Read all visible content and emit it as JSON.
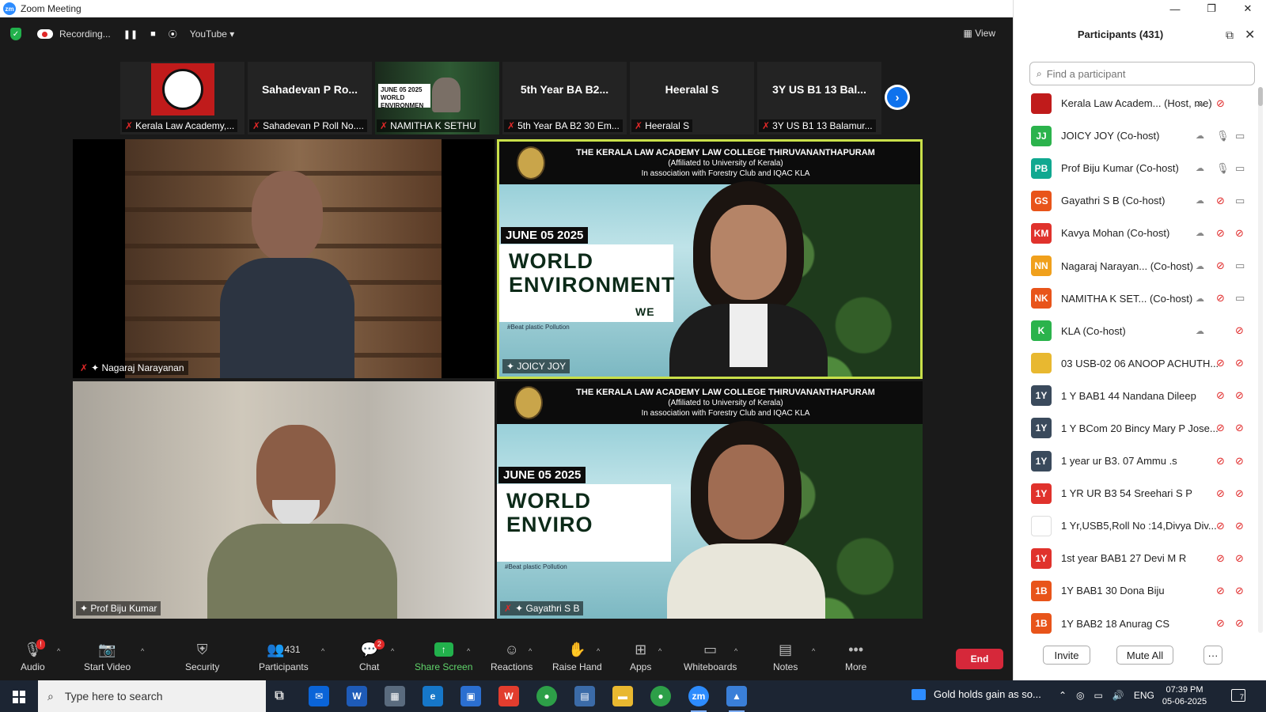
{
  "window": {
    "title": "Zoom Meeting"
  },
  "topbar": {
    "recording_label": "Recording...",
    "stream_label": "YouTube",
    "view_label": "View"
  },
  "thumbnails": [
    {
      "display": "",
      "name": "Kerala Law Academy,..."
    },
    {
      "display": "Sahadevan  P  Ro...",
      "name": "Sahadevan P Roll No...."
    },
    {
      "display": "",
      "name": "NAMITHA K SETHU"
    },
    {
      "display": "5th Year BA B2...",
      "name": "5th Year BA B2 30 Em..."
    },
    {
      "display": "Heeralal S",
      "name": "Heeralal S"
    },
    {
      "display": "3Y US B1 13 Bal...",
      "name": "3Y US B1 13 Balamur..."
    }
  ],
  "thumb_banner": {
    "date": "JUNE 05 2025",
    "title": "WORLD ENVIRONMEN"
  },
  "tiles": {
    "t1": {
      "name": "Nagaraj Narayanan"
    },
    "t2": {
      "name": "JOICY JOY"
    },
    "t3": {
      "name": "Prof Biju Kumar"
    },
    "t4": {
      "name": "Gayathri S B"
    }
  },
  "banner": {
    "line1": "THE KERALA LAW ACADEMY LAW COLLEGE THIRUVANANTHAPURAM",
    "line2": "(Affiliated to University of Kerala)",
    "line3": "In association with Forestry Club and IQAC KLA",
    "date": "JUNE 05 2025",
    "title": "WORLD ENVIRONMENT",
    "title_b": "WE",
    "hashtag": "#Beat plastic Pollution"
  },
  "toolbar": {
    "audio": "Audio",
    "start_video": "Start Video",
    "security": "Security",
    "participants": "Participants",
    "participants_count": "431",
    "chat": "Chat",
    "chat_badge": "2",
    "share_screen": "Share Screen",
    "reactions": "Reactions",
    "raise_hand": "Raise Hand",
    "apps": "Apps",
    "whiteboards": "Whiteboards",
    "notes": "Notes",
    "more": "More",
    "end": "End"
  },
  "panel": {
    "title": "Participants (431)",
    "search_placeholder": "Find a participant",
    "invite": "Invite",
    "mute_all": "Mute All",
    "more": "···"
  },
  "participants": [
    {
      "initials": "",
      "color": "#c01b1b",
      "name": "Kerala Law Academ...   (Host, me)",
      "cloud": true,
      "mic": "muted",
      "cam": ""
    },
    {
      "initials": "JJ",
      "color": "#2bb34c",
      "name": "JOICY JOY (Co-host)",
      "cloud": true,
      "mic": "on",
      "cam": "on"
    },
    {
      "initials": "PB",
      "color": "#10a890",
      "name": "Prof Biju Kumar (Co-host)",
      "cloud": true,
      "mic": "on",
      "cam": "on"
    },
    {
      "initials": "GS",
      "color": "#e8541a",
      "name": "Gayathri S B (Co-host)",
      "cloud": true,
      "mic": "muted",
      "cam": "on"
    },
    {
      "initials": "KM",
      "color": "#e0322c",
      "name": "Kavya Mohan (Co-host)",
      "cloud": true,
      "mic": "muted",
      "cam": "muted"
    },
    {
      "initials": "NN",
      "color": "#f0a01c",
      "name": "Nagaraj Narayan...  (Co-host)",
      "cloud": true,
      "mic": "muted",
      "cam": "on"
    },
    {
      "initials": "NK",
      "color": "#e8541a",
      "name": "NAMITHA K SET...    (Co-host)",
      "cloud": true,
      "mic": "muted",
      "cam": "on"
    },
    {
      "initials": "K",
      "color": "#2bb34c",
      "name": "KLA (Co-host)",
      "cloud": true,
      "mic": "",
      "cam": "muted"
    },
    {
      "initials": "",
      "color": "#e8b830",
      "name": "03 USB-02 06 ANOOP ACHUTH...",
      "cloud": false,
      "mic": "muted",
      "cam": "muted"
    },
    {
      "initials": "1Y",
      "color": "#3a4a5c",
      "name": "1 Y BAB1 44 Nandana Dileep",
      "cloud": false,
      "mic": "muted",
      "cam": "muted"
    },
    {
      "initials": "1Y",
      "color": "#3a4a5c",
      "name": "1 Y BCom 20 Bincy Mary P Jose...",
      "cloud": false,
      "mic": "muted",
      "cam": "muted"
    },
    {
      "initials": "1Y",
      "color": "#3a4a5c",
      "name": "1 year ur B3. 07 Ammu .s",
      "cloud": false,
      "mic": "muted",
      "cam": "muted"
    },
    {
      "initials": "1Y",
      "color": "#e0322c",
      "name": "1 YR UR B3 54 Sreehari S P",
      "cloud": false,
      "mic": "muted",
      "cam": "muted"
    },
    {
      "initials": "",
      "color": "#ffffff",
      "name": "1 Yr,USB5,Roll No :14,Divya Div...",
      "cloud": false,
      "mic": "muted",
      "cam": "muted"
    },
    {
      "initials": "1Y",
      "color": "#e0322c",
      "name": "1st year BAB1 27 Devi M R",
      "cloud": false,
      "mic": "muted",
      "cam": "muted"
    },
    {
      "initials": "1B",
      "color": "#e8541a",
      "name": "1Y BAB1 30 Dona Biju",
      "cloud": false,
      "mic": "muted",
      "cam": "muted"
    },
    {
      "initials": "1B",
      "color": "#e8541a",
      "name": "1Y BAB2 18 Anurag CS",
      "cloud": false,
      "mic": "muted",
      "cam": "muted"
    }
  ],
  "taskbar": {
    "search_placeholder": "Type here to search",
    "news": "Gold holds gain as so...",
    "lang": "ENG",
    "time": "07:39 PM",
    "date": "05-06-2025",
    "notifications": "7"
  }
}
